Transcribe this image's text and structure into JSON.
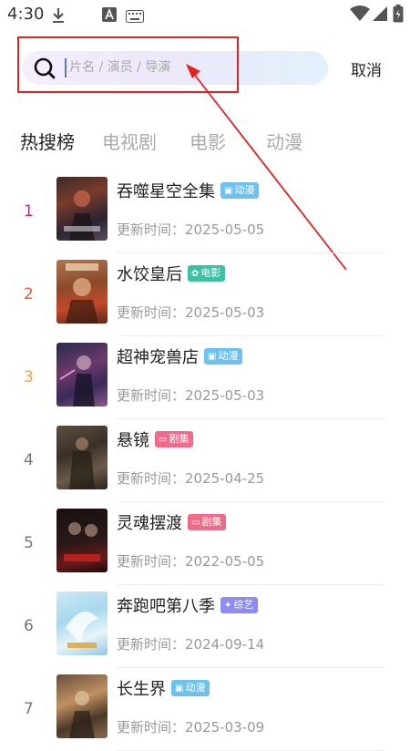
{
  "status_bar": {
    "time": "4:30",
    "left_icons": [
      "download-icon",
      "app-a-icon",
      "keyboard-icon"
    ],
    "right_icons": [
      "wifi-icon",
      "signal-icon",
      "battery-icon"
    ]
  },
  "search": {
    "placeholder": "片名 / 演员 / 导演",
    "value": "",
    "cancel_label": "取消"
  },
  "tabs": [
    {
      "label": "热搜榜",
      "active": true
    },
    {
      "label": "电视剧",
      "active": false
    },
    {
      "label": "电影",
      "active": false
    },
    {
      "label": "动漫",
      "active": false
    }
  ],
  "colors": {
    "rank_top": [
      "#e0197d",
      "#f2553b",
      "#f5a13a"
    ],
    "rank_default": "#777777",
    "badge_anime": "#6cc1ee",
    "badge_movie": "#3cc2a0",
    "badge_drama": "#f06a8a",
    "badge_variety": "#8e8bf1",
    "annotation": "#e02424"
  },
  "ranking": [
    {
      "rank": "1",
      "title": "吞噬星空全集",
      "badge": "动漫",
      "badge_icon": "tv-icon",
      "badge_type": "anime",
      "update": "更新时间：2025-05-05"
    },
    {
      "rank": "2",
      "title": "水饺皇后",
      "badge": "电影",
      "badge_icon": "film-reel-icon",
      "badge_type": "movie",
      "update": "更新时间：2025-05-03"
    },
    {
      "rank": "3",
      "title": "超神宠兽店",
      "badge": "动漫",
      "badge_icon": "tv-icon",
      "badge_type": "anime",
      "update": "更新时间：2025-05-03"
    },
    {
      "rank": "4",
      "title": "悬镜",
      "badge": "剧集",
      "badge_icon": "drama-icon",
      "badge_type": "drama",
      "update": "更新时间：2025-04-25"
    },
    {
      "rank": "5",
      "title": "灵魂摆渡",
      "badge": "剧集",
      "badge_icon": "drama-icon",
      "badge_type": "drama",
      "update": "更新时间：2022-05-05"
    },
    {
      "rank": "6",
      "title": "奔跑吧第八季",
      "badge": "综艺",
      "badge_icon": "star-icon",
      "badge_type": "variety",
      "update": "更新时间：2024-09-14"
    },
    {
      "rank": "7",
      "title": "长生界",
      "badge": "动漫",
      "badge_icon": "tv-icon",
      "badge_type": "anime",
      "update": "更新时间：2025-03-09"
    }
  ]
}
